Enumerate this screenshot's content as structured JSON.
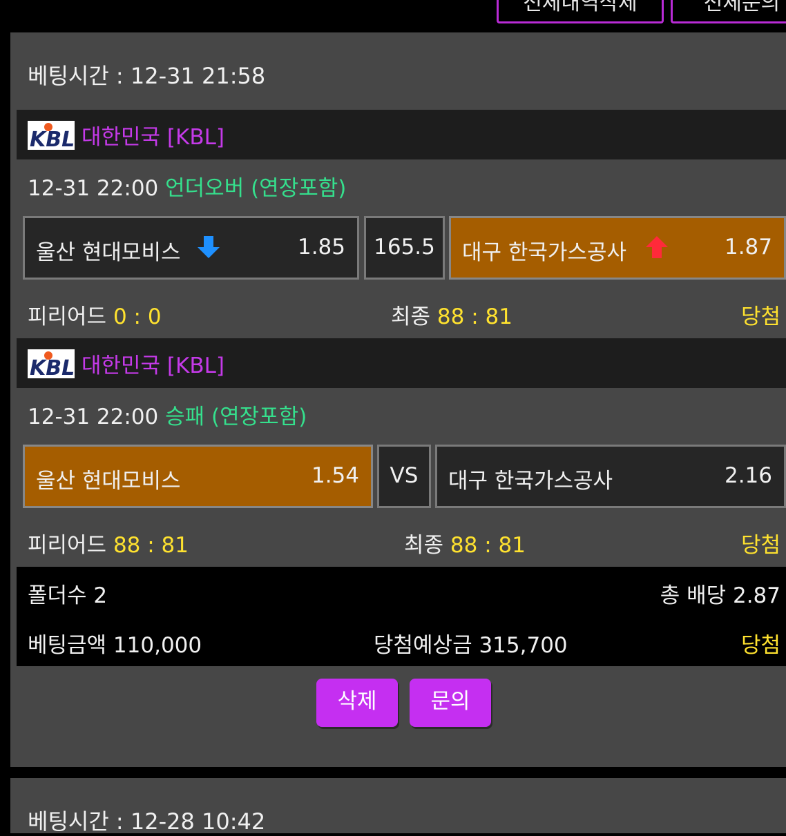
{
  "top_buttons": [
    "전체내역삭제",
    "전체문의"
  ],
  "bets": [
    {
      "bet_time": "베팅시간 : 12-31 21:58",
      "games": [
        {
          "league": "대한민국 [KBL]",
          "datetime": "12-31 22:00",
          "bet_type": "언더오버 (연장포함)",
          "home": {
            "name": "울산 현대모비스",
            "odds": "1.85",
            "arrow": "down-arrow-icon"
          },
          "middle": "165.5",
          "away": {
            "name": "대구 한국가스공사",
            "odds": "1.87",
            "arrow": "up-arrow-icon"
          },
          "selected": "away",
          "period_label": "피리어드",
          "period_score": "0 : 0",
          "final_label": "최종",
          "final_score": "88 : 81",
          "result": "당첨"
        },
        {
          "league": "대한민국 [KBL]",
          "datetime": "12-31 22:00",
          "bet_type": "승패 (연장포함)",
          "home": {
            "name": "울산 현대모비스",
            "odds": "1.54"
          },
          "middle": "VS",
          "away": {
            "name": "대구 한국가스공사",
            "odds": "2.16"
          },
          "selected": "home",
          "period_label": "피리어드",
          "period_score": "88 : 81",
          "final_label": "최종",
          "final_score": "88 : 81",
          "result": "당첨"
        }
      ],
      "summary": {
        "folders": "폴더수 2",
        "total_odds": "총 배당 2.87",
        "bet_amount": "베팅금액 110,000",
        "expected_win": "당첨예상금 315,700",
        "result": "당첨"
      },
      "actions": {
        "delete": "삭제",
        "inquiry": "문의"
      }
    },
    {
      "bet_time": "베팅시간 : 12-28 10:42"
    }
  ],
  "logo_text": "KBL",
  "colors": {
    "panel_bg": "#474747",
    "league_bg": "#1d1d1d",
    "selected_bg": "#a55d00",
    "league_text": "#c53ae9",
    "bet_type_text": "#35e08d",
    "score_text": "#ffe22f",
    "button_bg": "#c52ff1",
    "up_arrow": "#ff2a3a",
    "down_arrow": "#1e90ff"
  }
}
